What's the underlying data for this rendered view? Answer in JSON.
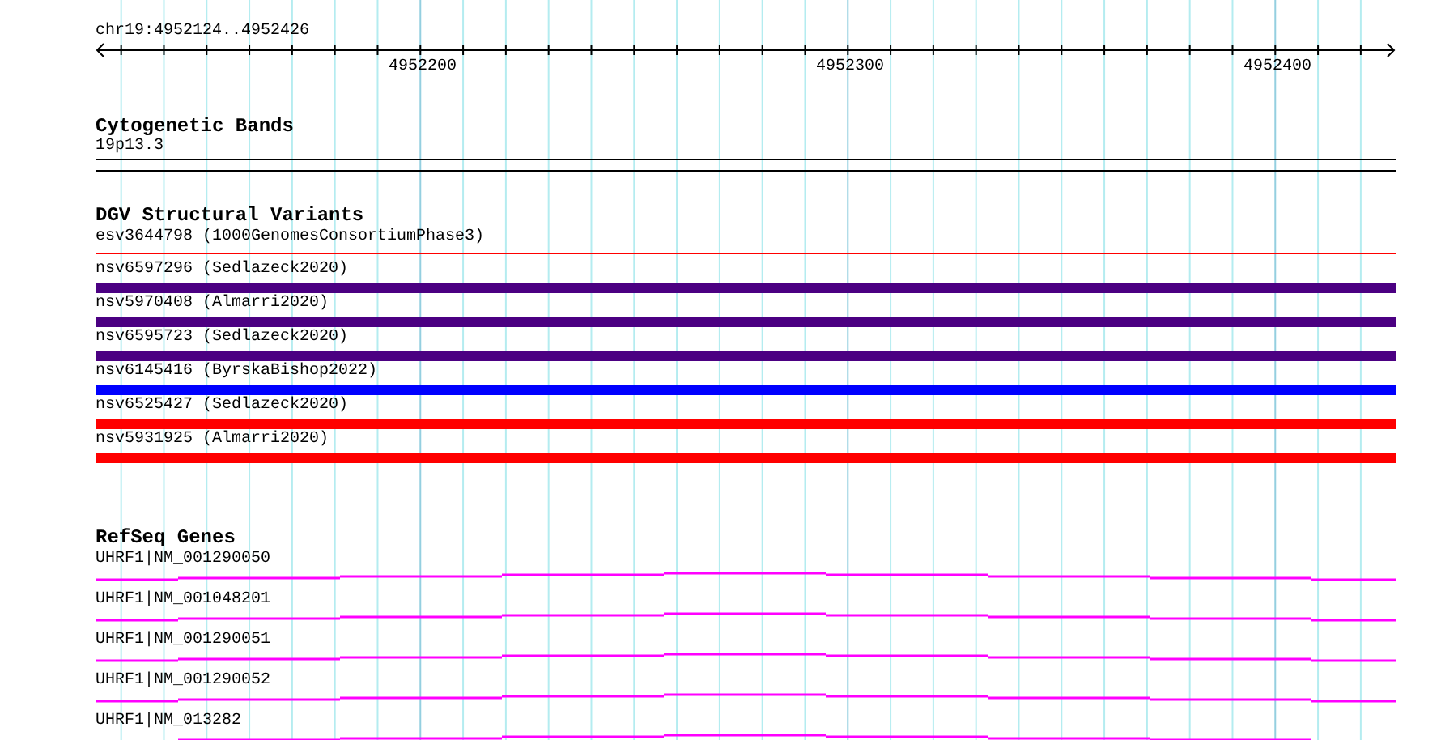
{
  "ruler": {
    "location": "chr19:4952124..4952426",
    "ticks": [
      "4952200",
      "4952300",
      "4952400"
    ]
  },
  "cytogenetic_bands": {
    "title": "Cytogenetic Bands",
    "band": "19p13.3"
  },
  "dgv": {
    "title": "DGV Structural Variants",
    "variants": [
      {
        "label": "esv3644798 (1000GenomesConsortiumPhase3)",
        "kind": "thin",
        "color": "#ff0000"
      },
      {
        "label": "nsv6597296 (Sedlazeck2020)",
        "kind": "thick",
        "color": "#4b0082"
      },
      {
        "label": "nsv5970408 (Almarri2020)",
        "kind": "thick",
        "color": "#4b0082"
      },
      {
        "label": "nsv6595723 (Sedlazeck2020)",
        "kind": "thick",
        "color": "#4b0082"
      },
      {
        "label": "nsv6145416 (ByrskaBishop2022)",
        "kind": "thick",
        "color": "#0000ff"
      },
      {
        "label": "nsv6525427 (Sedlazeck2020)",
        "kind": "thick",
        "color": "#ff0000"
      },
      {
        "label": "nsv5931925 (Almarri2020)",
        "kind": "thick",
        "color": "#ff0000"
      }
    ]
  },
  "refseq": {
    "title": "RefSeq Genes",
    "genes": [
      {
        "label": "UHRF1|NM_001290050"
      },
      {
        "label": "UHRF1|NM_001048201"
      },
      {
        "label": "UHRF1|NM_001290051"
      },
      {
        "label": "UHRF1|NM_001290052"
      },
      {
        "label": "UHRF1|NM_013282"
      }
    ]
  }
}
